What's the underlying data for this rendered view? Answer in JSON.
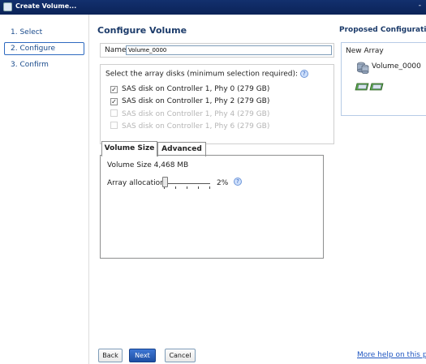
{
  "window": {
    "title": "Create Volume...",
    "dash": "-"
  },
  "nav": {
    "items": [
      {
        "label": "1. Select"
      },
      {
        "label": "2. Configure"
      },
      {
        "label": "3. Confirm"
      }
    ],
    "active_index": 1
  },
  "configure": {
    "heading": "Configure Volume",
    "name_label": "Name:",
    "name_value": "Volume_0000",
    "disks_intro": "Select the array disks (minimum selection required):",
    "disks": [
      {
        "label": "SAS disk on Controller 1, Phy 0 (279 GB)",
        "checked": true,
        "enabled": true
      },
      {
        "label": "SAS disk on Controller 1, Phy 2 (279 GB)",
        "checked": true,
        "enabled": true
      },
      {
        "label": "SAS disk on Controller 1, Phy 4 (279 GB)",
        "checked": false,
        "enabled": false
      },
      {
        "label": "SAS disk on Controller 1, Phy 6 (279 GB)",
        "checked": false,
        "enabled": false
      }
    ],
    "tabs": [
      {
        "label": "Volume Size",
        "selected": true
      },
      {
        "label": "Advanced",
        "selected": false
      }
    ],
    "volume_size": "Volume Size 4,468 MB",
    "allocation_label": "Array allocation:",
    "allocation_percent": "2%",
    "allocation_value": 0.02
  },
  "buttons": {
    "back": "Back",
    "next": "Next",
    "cancel": "Cancel"
  },
  "proposed": {
    "title": "Proposed Configuration",
    "array_label": "New Array",
    "volume_name": "Volume_0000"
  },
  "help_link": "More help on this page",
  "colors": {
    "titlebar": "#0b2358",
    "link": "#1f56c1",
    "primary_button": "#1e4fa3"
  }
}
